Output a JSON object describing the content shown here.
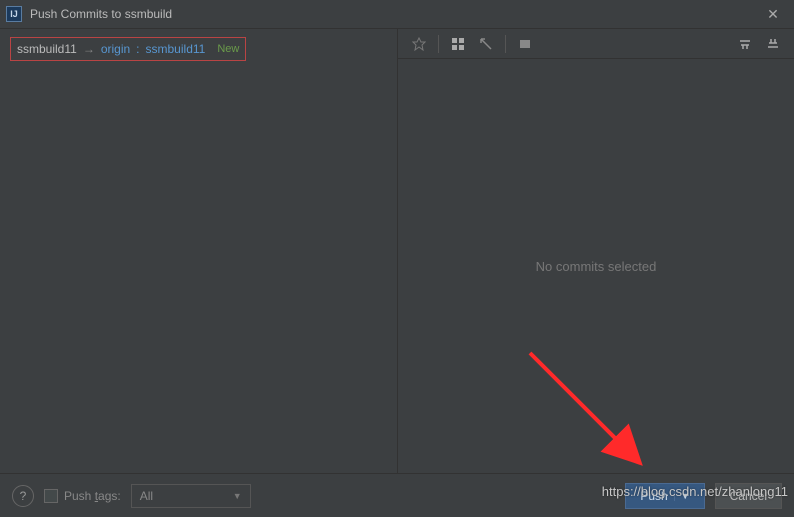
{
  "window": {
    "app_icon_text": "IJ",
    "title": "Push Commits to ssmbuild"
  },
  "branch": {
    "local": "ssmbuild11",
    "arrow": "→",
    "remote_name": "origin",
    "colon": ":",
    "remote_branch": "ssmbuild11",
    "new_badge": "New"
  },
  "right": {
    "empty_text": "No commits selected"
  },
  "bottom": {
    "help": "?",
    "push_tags_label_pre": "Push ",
    "push_tags_label_u": "t",
    "push_tags_label_post": "ags:",
    "combo_value": "All",
    "push_label": "Push",
    "cancel_label": "Cancel"
  },
  "watermark": "https://blog.csdn.net/zhanlong11"
}
